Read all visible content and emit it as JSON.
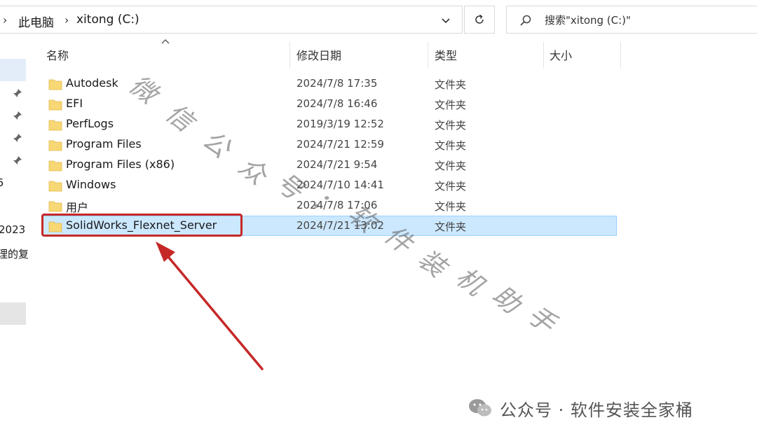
{
  "address_bar": {
    "crumbs": [
      "此电脑",
      "xitong (C:)"
    ]
  },
  "search": {
    "placeholder": "搜索\"xitong (C:)\""
  },
  "nav_pane": {
    "partial_labels": [
      "5",
      "2023",
      "理的复"
    ]
  },
  "columns": {
    "name": "名称",
    "date": "修改日期",
    "type": "类型",
    "size": "大小"
  },
  "files": [
    {
      "name": "Autodesk",
      "date": "2024/7/8 17:35",
      "type": "文件夹",
      "selected": false
    },
    {
      "name": "EFI",
      "date": "2024/7/8 16:46",
      "type": "文件夹",
      "selected": false
    },
    {
      "name": "PerfLogs",
      "date": "2019/3/19 12:52",
      "type": "文件夹",
      "selected": false
    },
    {
      "name": "Program Files",
      "date": "2024/7/21 12:59",
      "type": "文件夹",
      "selected": false
    },
    {
      "name": "Program Files (x86)",
      "date": "2024/7/21 9:54",
      "type": "文件夹",
      "selected": false
    },
    {
      "name": "Windows",
      "date": "2024/7/10 14:41",
      "type": "文件夹",
      "selected": false
    },
    {
      "name": "用户",
      "date": "2024/7/8 17:06",
      "type": "文件夹",
      "selected": false
    },
    {
      "name": "SolidWorks_Flexnet_Server",
      "date": "2024/7/21 13:02",
      "type": "文件夹",
      "selected": true
    }
  ],
  "watermark": {
    "diagonal_chars": [
      "微",
      "信",
      "公",
      "众",
      "号",
      "：",
      "软",
      "件",
      "装",
      "机",
      "助",
      "手"
    ],
    "footer": "公众号 · 软件安装全家桶"
  },
  "colors": {
    "selection_bg": "#cce8ff",
    "selection_border": "#99d1ff",
    "highlight_red": "#c62828",
    "folder_yellow": "#f8d775"
  },
  "icons": {
    "folder": "folder-icon",
    "search": "search-icon",
    "refresh": "refresh-icon",
    "pin": "pin-icon",
    "chevron": "chevron-right-icon",
    "dropdown": "chevron-down-icon",
    "sort": "sort-up-icon",
    "footer_logo": "wechat-icon"
  }
}
